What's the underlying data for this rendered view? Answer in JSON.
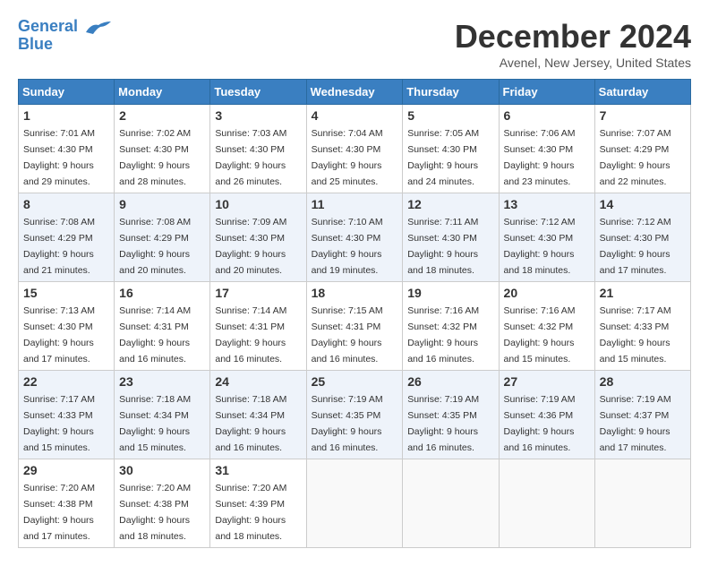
{
  "header": {
    "logo_line1": "General",
    "logo_line2": "Blue",
    "month_title": "December 2024",
    "location": "Avenel, New Jersey, United States"
  },
  "days_of_week": [
    "Sunday",
    "Monday",
    "Tuesday",
    "Wednesday",
    "Thursday",
    "Friday",
    "Saturday"
  ],
  "weeks": [
    [
      {
        "day": 1,
        "sunrise": "7:01 AM",
        "sunset": "4:30 PM",
        "daylight": "9 hours and 29 minutes."
      },
      {
        "day": 2,
        "sunrise": "7:02 AM",
        "sunset": "4:30 PM",
        "daylight": "9 hours and 28 minutes."
      },
      {
        "day": 3,
        "sunrise": "7:03 AM",
        "sunset": "4:30 PM",
        "daylight": "9 hours and 26 minutes."
      },
      {
        "day": 4,
        "sunrise": "7:04 AM",
        "sunset": "4:30 PM",
        "daylight": "9 hours and 25 minutes."
      },
      {
        "day": 5,
        "sunrise": "7:05 AM",
        "sunset": "4:30 PM",
        "daylight": "9 hours and 24 minutes."
      },
      {
        "day": 6,
        "sunrise": "7:06 AM",
        "sunset": "4:30 PM",
        "daylight": "9 hours and 23 minutes."
      },
      {
        "day": 7,
        "sunrise": "7:07 AM",
        "sunset": "4:29 PM",
        "daylight": "9 hours and 22 minutes."
      }
    ],
    [
      {
        "day": 8,
        "sunrise": "7:08 AM",
        "sunset": "4:29 PM",
        "daylight": "9 hours and 21 minutes."
      },
      {
        "day": 9,
        "sunrise": "7:08 AM",
        "sunset": "4:29 PM",
        "daylight": "9 hours and 20 minutes."
      },
      {
        "day": 10,
        "sunrise": "7:09 AM",
        "sunset": "4:30 PM",
        "daylight": "9 hours and 20 minutes."
      },
      {
        "day": 11,
        "sunrise": "7:10 AM",
        "sunset": "4:30 PM",
        "daylight": "9 hours and 19 minutes."
      },
      {
        "day": 12,
        "sunrise": "7:11 AM",
        "sunset": "4:30 PM",
        "daylight": "9 hours and 18 minutes."
      },
      {
        "day": 13,
        "sunrise": "7:12 AM",
        "sunset": "4:30 PM",
        "daylight": "9 hours and 18 minutes."
      },
      {
        "day": 14,
        "sunrise": "7:12 AM",
        "sunset": "4:30 PM",
        "daylight": "9 hours and 17 minutes."
      }
    ],
    [
      {
        "day": 15,
        "sunrise": "7:13 AM",
        "sunset": "4:30 PM",
        "daylight": "9 hours and 17 minutes."
      },
      {
        "day": 16,
        "sunrise": "7:14 AM",
        "sunset": "4:31 PM",
        "daylight": "9 hours and 16 minutes."
      },
      {
        "day": 17,
        "sunrise": "7:14 AM",
        "sunset": "4:31 PM",
        "daylight": "9 hours and 16 minutes."
      },
      {
        "day": 18,
        "sunrise": "7:15 AM",
        "sunset": "4:31 PM",
        "daylight": "9 hours and 16 minutes."
      },
      {
        "day": 19,
        "sunrise": "7:16 AM",
        "sunset": "4:32 PM",
        "daylight": "9 hours and 16 minutes."
      },
      {
        "day": 20,
        "sunrise": "7:16 AM",
        "sunset": "4:32 PM",
        "daylight": "9 hours and 15 minutes."
      },
      {
        "day": 21,
        "sunrise": "7:17 AM",
        "sunset": "4:33 PM",
        "daylight": "9 hours and 15 minutes."
      }
    ],
    [
      {
        "day": 22,
        "sunrise": "7:17 AM",
        "sunset": "4:33 PM",
        "daylight": "9 hours and 15 minutes."
      },
      {
        "day": 23,
        "sunrise": "7:18 AM",
        "sunset": "4:34 PM",
        "daylight": "9 hours and 15 minutes."
      },
      {
        "day": 24,
        "sunrise": "7:18 AM",
        "sunset": "4:34 PM",
        "daylight": "9 hours and 16 minutes."
      },
      {
        "day": 25,
        "sunrise": "7:19 AM",
        "sunset": "4:35 PM",
        "daylight": "9 hours and 16 minutes."
      },
      {
        "day": 26,
        "sunrise": "7:19 AM",
        "sunset": "4:35 PM",
        "daylight": "9 hours and 16 minutes."
      },
      {
        "day": 27,
        "sunrise": "7:19 AM",
        "sunset": "4:36 PM",
        "daylight": "9 hours and 16 minutes."
      },
      {
        "day": 28,
        "sunrise": "7:19 AM",
        "sunset": "4:37 PM",
        "daylight": "9 hours and 17 minutes."
      }
    ],
    [
      {
        "day": 29,
        "sunrise": "7:20 AM",
        "sunset": "4:38 PM",
        "daylight": "9 hours and 17 minutes."
      },
      {
        "day": 30,
        "sunrise": "7:20 AM",
        "sunset": "4:38 PM",
        "daylight": "9 hours and 18 minutes."
      },
      {
        "day": 31,
        "sunrise": "7:20 AM",
        "sunset": "4:39 PM",
        "daylight": "9 hours and 18 minutes."
      },
      null,
      null,
      null,
      null
    ]
  ]
}
